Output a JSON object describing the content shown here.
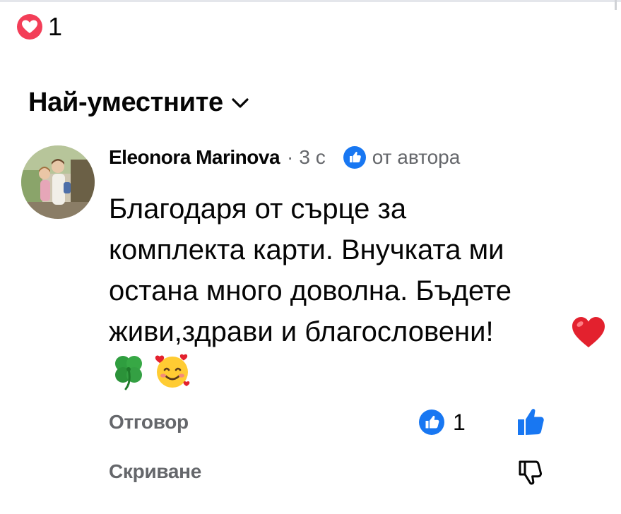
{
  "reactions_summary": {
    "count": "1",
    "icon": "love-reaction-icon",
    "color": "#f33e58"
  },
  "sort": {
    "label": "Най-уместните",
    "icon": "chevron-down-icon"
  },
  "comment": {
    "author": "Eleonora Marinova",
    "separator": "·",
    "time": "3 с",
    "author_badge": {
      "icon": "author-badge-icon",
      "label": "от автора",
      "color": "#1877f2"
    },
    "text_lines": [
      "Благодаря от сърце за",
      "комплекта карти. Внучката ми",
      "остана много доволна. Бъдете",
      "живи,здрави и благословени!"
    ],
    "emojis": [
      "red-heart-emoji",
      "four-leaf-clover-emoji",
      "smiling-face-with-hearts-emoji"
    ],
    "actions": {
      "reply": "Отговор",
      "hide": "Скриване"
    },
    "reaction_count": "1",
    "like_color": "#1877f2"
  }
}
